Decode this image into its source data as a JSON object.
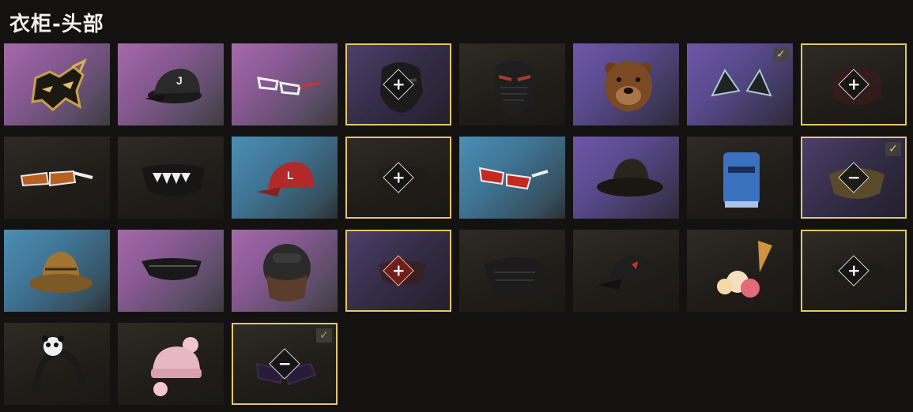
{
  "title": "衣柜-头部",
  "tiles": [
    {
      "name": "gold-mask",
      "bg": "pink"
    },
    {
      "name": "black-cap-j",
      "bg": "pink"
    },
    {
      "name": "white-glasses",
      "bg": "pink"
    },
    {
      "name": "black-face-mask",
      "bg": "violetdark",
      "selected": true,
      "action": "+"
    },
    {
      "name": "ninja-mask",
      "bg": "dark"
    },
    {
      "name": "bear-head",
      "bg": "purple"
    },
    {
      "name": "cat-ears",
      "bg": "purple",
      "checked": true
    },
    {
      "name": "red-mask",
      "bg": "dark",
      "selected": true,
      "action": "+"
    },
    {
      "name": "sport-sunglasses",
      "bg": "dark"
    },
    {
      "name": "teeth-face-mask",
      "bg": "dark"
    },
    {
      "name": "red-cap-l",
      "bg": "blue"
    },
    {
      "name": "dark-item",
      "bg": "dark",
      "selected": true,
      "action": "+"
    },
    {
      "name": "red-sunglasses",
      "bg": "blue"
    },
    {
      "name": "bucket-hat-dark",
      "bg": "purple"
    },
    {
      "name": "blue-helmet",
      "bg": "dark"
    },
    {
      "name": "camo-mask",
      "bg": "violetdark",
      "selected": true,
      "checked": true,
      "action": "−"
    },
    {
      "name": "bucket-hat-tan",
      "bg": "blue"
    },
    {
      "name": "black-eyepatch",
      "bg": "pink"
    },
    {
      "name": "pilot-helmet",
      "bg": "pink"
    },
    {
      "name": "red-item",
      "bg": "violetdark",
      "selected": true,
      "action": "+",
      "actionStyle": "red"
    },
    {
      "name": "black-respirator",
      "bg": "dark"
    },
    {
      "name": "black-cap-red",
      "bg": "dark"
    },
    {
      "name": "ice-cream-hat",
      "bg": "dark"
    },
    {
      "name": "dark-goggles",
      "bg": "dark",
      "selected": true,
      "action": "+"
    },
    {
      "name": "panda-headband",
      "bg": "dark"
    },
    {
      "name": "pink-beanie",
      "bg": "dark"
    },
    {
      "name": "purple-glasses",
      "bg": "dark",
      "selected": true,
      "checked": true,
      "checkDim": true,
      "action": "−"
    }
  ]
}
